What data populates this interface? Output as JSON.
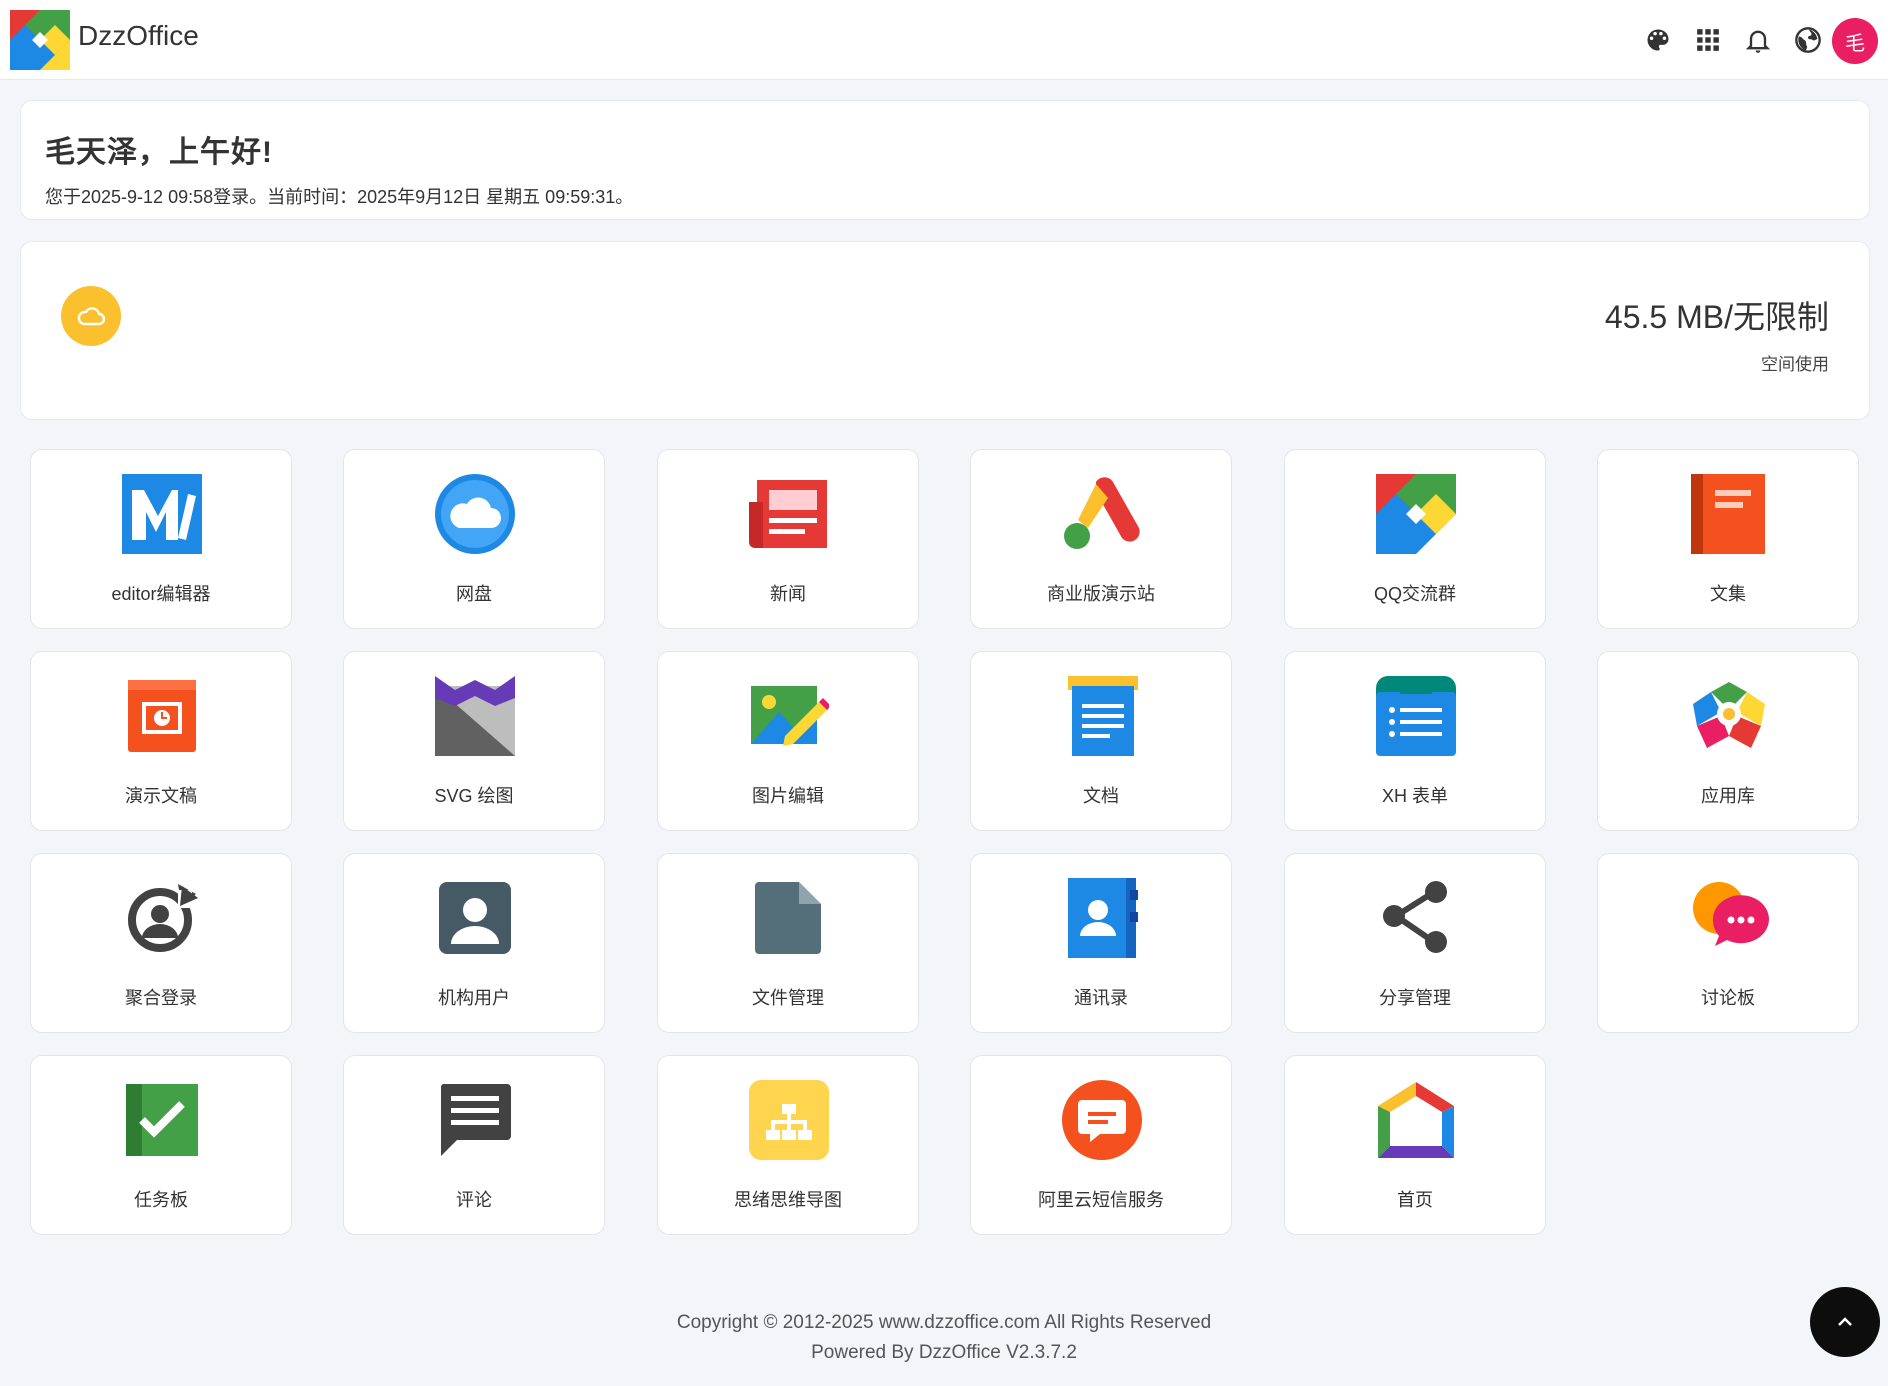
{
  "header": {
    "brand": "DzzOffice",
    "icons": [
      "palette-icon",
      "apps-grid-icon",
      "bell-icon",
      "globe-icon"
    ],
    "avatar_text": "毛"
  },
  "greeting": {
    "title": "毛天泽，上午好!",
    "info": "您于2025-9-12 09:58登录。当前时间：2025年9月12日  星期五  09:59:31。"
  },
  "storage": {
    "icon": "cloud-icon",
    "value": "45.5 MB/无限制",
    "label": "空间使用"
  },
  "apps": [
    {
      "label": "editor编辑器",
      "icon": "editor-icon"
    },
    {
      "label": "网盘",
      "icon": "cloud-drive-icon"
    },
    {
      "label": "新闻",
      "icon": "news-icon"
    },
    {
      "label": "商业版演示站",
      "icon": "demo-site-icon"
    },
    {
      "label": "QQ交流群",
      "icon": "qq-group-icon"
    },
    {
      "label": "文集",
      "icon": "notebook-icon"
    },
    {
      "label": "演示文稿",
      "icon": "presentation-icon"
    },
    {
      "label": "SVG 绘图",
      "icon": "svg-drawing-icon"
    },
    {
      "label": "图片编辑",
      "icon": "image-editor-icon"
    },
    {
      "label": "文档",
      "icon": "document-icon"
    },
    {
      "label": "XH 表单",
      "icon": "form-icon"
    },
    {
      "label": "应用库",
      "icon": "app-store-icon"
    },
    {
      "label": "聚合登录",
      "icon": "login-aggregate-icon"
    },
    {
      "label": "机构用户",
      "icon": "org-user-icon"
    },
    {
      "label": "文件管理",
      "icon": "file-manager-icon"
    },
    {
      "label": "通讯录",
      "icon": "contacts-icon"
    },
    {
      "label": "分享管理",
      "icon": "share-icon"
    },
    {
      "label": "讨论板",
      "icon": "discussion-icon"
    },
    {
      "label": "任务板",
      "icon": "task-board-icon"
    },
    {
      "label": "评论",
      "icon": "comment-icon"
    },
    {
      "label": "思绪思维导图",
      "icon": "mindmap-icon"
    },
    {
      "label": "阿里云短信服务",
      "icon": "sms-icon"
    },
    {
      "label": "首页",
      "icon": "home-icon"
    }
  ],
  "footer": {
    "copyright": "Copyright © 2012-2025 www.dzzoffice.com All Rights Reserved",
    "powered": "Powered By DzzOffice V2.3.7.2"
  },
  "back_to_top_icon": "chevron-up-icon"
}
